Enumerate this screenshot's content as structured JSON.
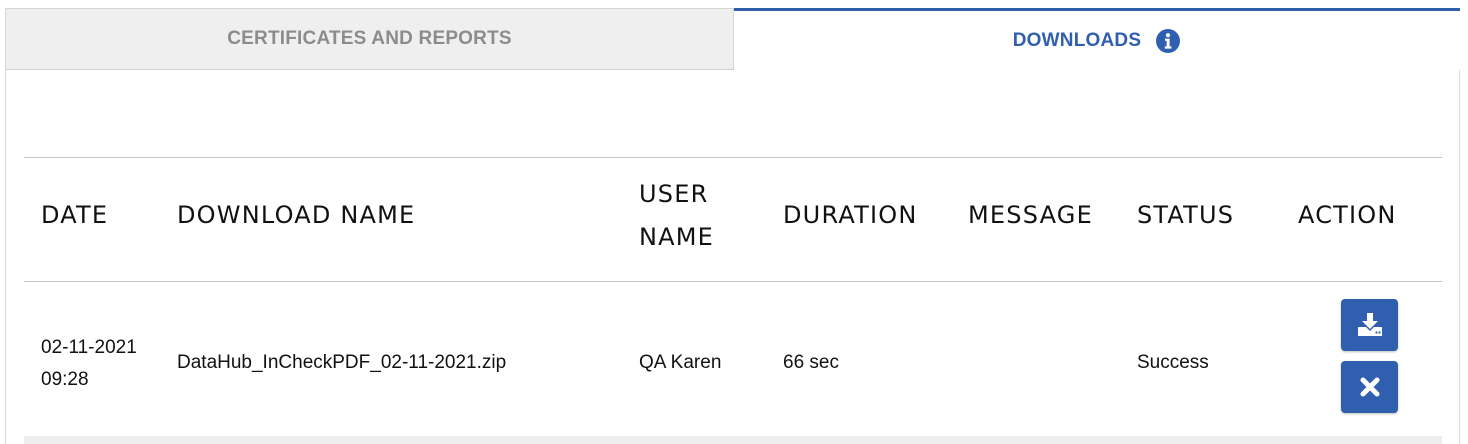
{
  "tabs": {
    "certificates_label": "CERTIFICATES AND REPORTS",
    "downloads_label": "DOWNLOADS",
    "active": "DOWNLOADS"
  },
  "table": {
    "headers": {
      "date": "DATE",
      "download_name": "DOWNLOAD NAME",
      "user_name_line1": "USER",
      "user_name_line2": "NAME",
      "duration": "DURATION",
      "message": "MESSAGE",
      "status": "STATUS",
      "action": "ACTION"
    },
    "rows": [
      {
        "date_line1": "02-11-2021",
        "date_line2": "09:28",
        "download_name": "DataHub_InCheckPDF_02-11-2021.zip",
        "user_name": "QA Karen",
        "duration": "66 sec",
        "message": "",
        "status": "Success",
        "actions": [
          "download-icon",
          "close-icon"
        ]
      }
    ]
  },
  "colors": {
    "accent": "#2f5fae",
    "inactive_tab_bg": "#efefef",
    "inactive_tab_text": "#8c8c8c"
  },
  "icons": {
    "info": "info-circle-icon",
    "download": "download-icon",
    "delete": "close-icon"
  }
}
